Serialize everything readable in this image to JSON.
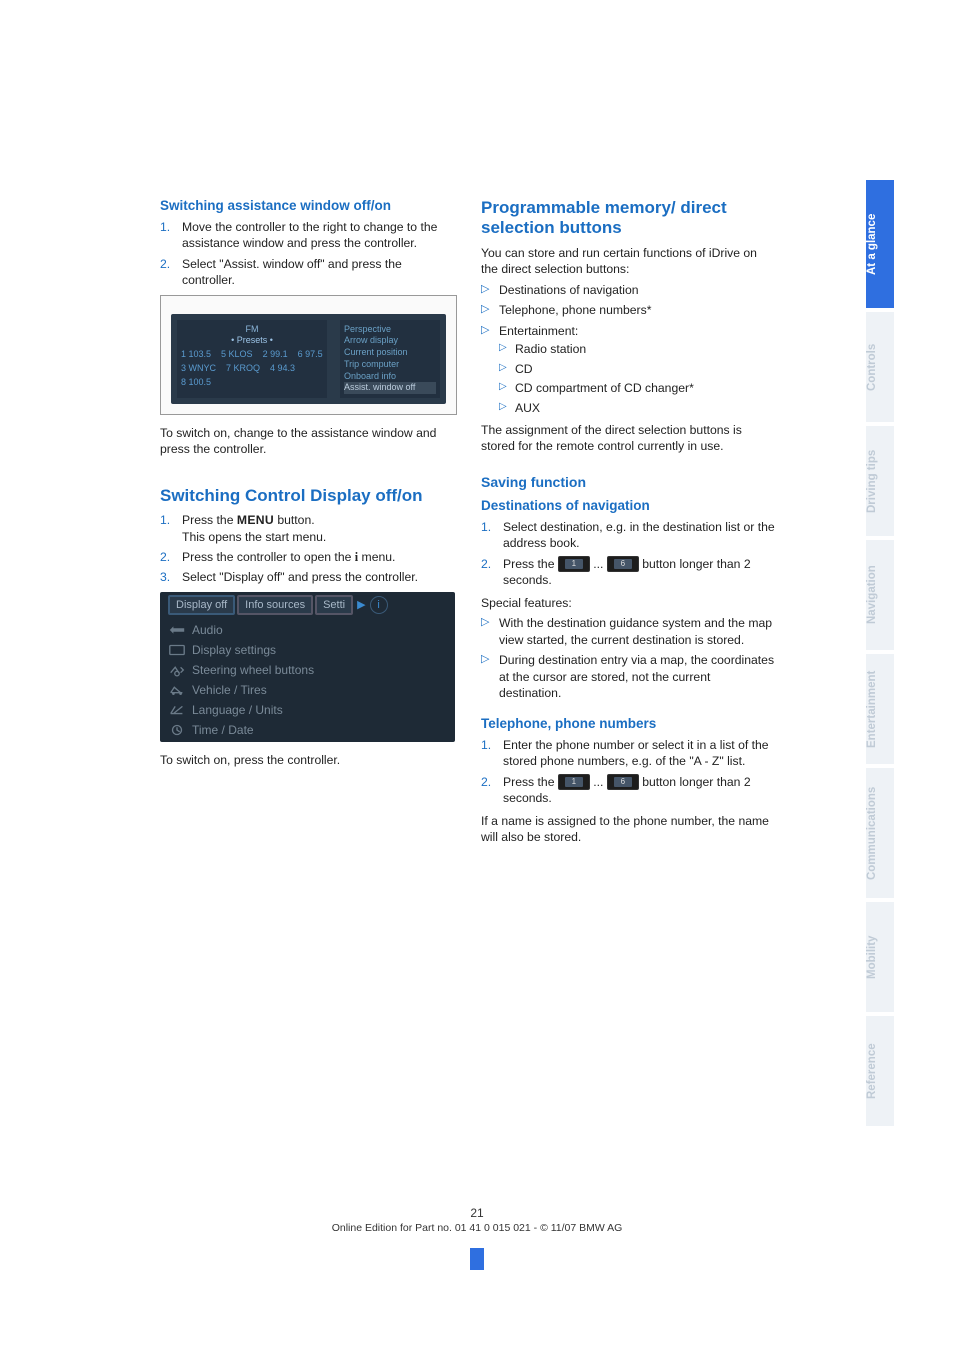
{
  "left": {
    "h1": "Switching assistance window off/on",
    "steps1": [
      "Move the controller to the right to change to the assistance window and press the controller.",
      "Select \"Assist. window off\" and press the controller."
    ],
    "img1": {
      "leftCol": [
        "• Presets •",
        "1 103.5",
        "2 99.1",
        "3 WNYC",
        "4 94.3",
        "5 KLOS",
        "6 97.5",
        "7 KROQ",
        "8 100.5"
      ],
      "rightCol": [
        "Perspective",
        "Arrow display",
        "Current position",
        "Trip computer",
        "Onboard info",
        "Assist. window off"
      ]
    },
    "p1": "To switch on, change to the assistance window and press the controller.",
    "h2": "Switching Control Display off/on",
    "steps2_1a": "Press the ",
    "steps2_1b_menu": "MENU",
    "steps2_1c": " button.",
    "steps2_1d": "This opens the start menu.",
    "steps2_2a": "Press the controller to open the ",
    "steps2_2b_i": "i",
    "steps2_2c": " menu.",
    "steps2_3": "Select \"Display off\" and press the controller.",
    "img2": {
      "tabs": [
        "Display off",
        "Info sources",
        "Setti"
      ],
      "items": [
        "Audio",
        "Display settings",
        "Steering wheel buttons",
        "Vehicle / Tires",
        "Language / Units",
        "Time / Date"
      ]
    },
    "p2": "To switch on, press the controller."
  },
  "right": {
    "h1": "Programmable memory/ direct selection buttons",
    "p1": "You can store and run certain functions of iDrive on the direct selection buttons:",
    "bul1": [
      "Destinations of navigation",
      "Telephone, phone numbers*",
      "Entertainment:"
    ],
    "bul1sub": [
      "Radio station",
      "CD",
      "CD compartment of CD changer*",
      "AUX"
    ],
    "p2": "The assignment of the direct selection buttons is stored for the remote control currently in use.",
    "h2": "Saving function",
    "h3a": "Destinations of navigation",
    "dest_step1": "Select destination, e.g. in the destination list or the address book.",
    "press_a": "Press the ",
    "press_mid": " ... ",
    "press_b": " button longer than 2 seconds.",
    "key1": "1",
    "key6": "6",
    "spec_h": "Special features:",
    "spec": [
      "With the destination guidance system and the map view started, the current destination is stored.",
      "During destination entry via a map, the coordinates at the cursor are stored, not the current destination."
    ],
    "h3b": "Telephone, phone numbers",
    "tel_step1": "Enter the phone number or select it in a list of the stored phone numbers, e.g. of the \"A - Z\" list.",
    "p3": "If a name is assigned to the phone number, the name will also be stored."
  },
  "tabs": [
    "At a glance",
    "Controls",
    "Driving tips",
    "Navigation",
    "Entertainment",
    "Communications",
    "Mobility",
    "Reference"
  ],
  "footer": {
    "page": "21",
    "line": "Online Edition for Part no. 01 41 0 015 021 - © 11/07 BMW AG"
  }
}
